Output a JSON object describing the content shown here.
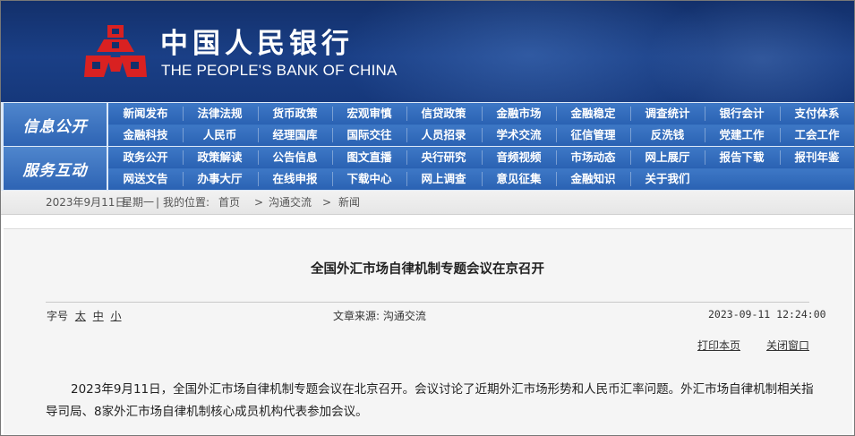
{
  "header": {
    "logo_cn": "中国人民银行",
    "logo_en": "THE PEOPLE'S BANK OF CHINA",
    "colors": {
      "header_bg": "#16387b",
      "emblem_red": "#d92121"
    }
  },
  "nav": {
    "info_label": "信息公开",
    "service_label": "服务互动",
    "info_rows": [
      [
        "新闻发布",
        "法律法规",
        "货币政策",
        "宏观审慎",
        "信贷政策",
        "金融市场",
        "金融稳定",
        "调查统计",
        "银行会计",
        "支付体系"
      ],
      [
        "金融科技",
        "人民币",
        "经理国库",
        "国际交往",
        "人员招录",
        "学术交流",
        "征信管理",
        "反洗钱",
        "党建工作",
        "工会工作"
      ]
    ],
    "service_rows": [
      [
        "政务公开",
        "政策解读",
        "公告信息",
        "图文直播",
        "央行研究",
        "音频视频",
        "市场动态",
        "网上展厅",
        "报告下载",
        "报刊年鉴"
      ],
      [
        "网送文告",
        "办事大厅",
        "在线申报",
        "下载中心",
        "网上调查",
        "意见征集",
        "金融知识",
        "关于我们"
      ]
    ]
  },
  "breadcrumb": {
    "date": "2023年9月11日",
    "weekday": "星期一",
    "location_label": "我的位置:",
    "home": "首页",
    "sep": ">",
    "level1": "沟通交流",
    "level2": "新闻"
  },
  "article": {
    "title": "全国外汇市场自律机制专题会议在京召开",
    "font_size_label": "字号",
    "font_sizes": [
      "太",
      "中",
      "小"
    ],
    "source": "文章来源: 沟通交流",
    "datetime": "2023-09-11 12:24:00",
    "print_label": "打印本页",
    "close_label": "关闭窗口",
    "body": "2023年9月11日，全国外汇市场自律机制专题会议在北京召开。会议讨论了近期外汇市场形势和人民币汇率问题。外汇市场自律机制相关指导司局、8家外汇市场自律机制核心成员机构代表参加会议。"
  }
}
